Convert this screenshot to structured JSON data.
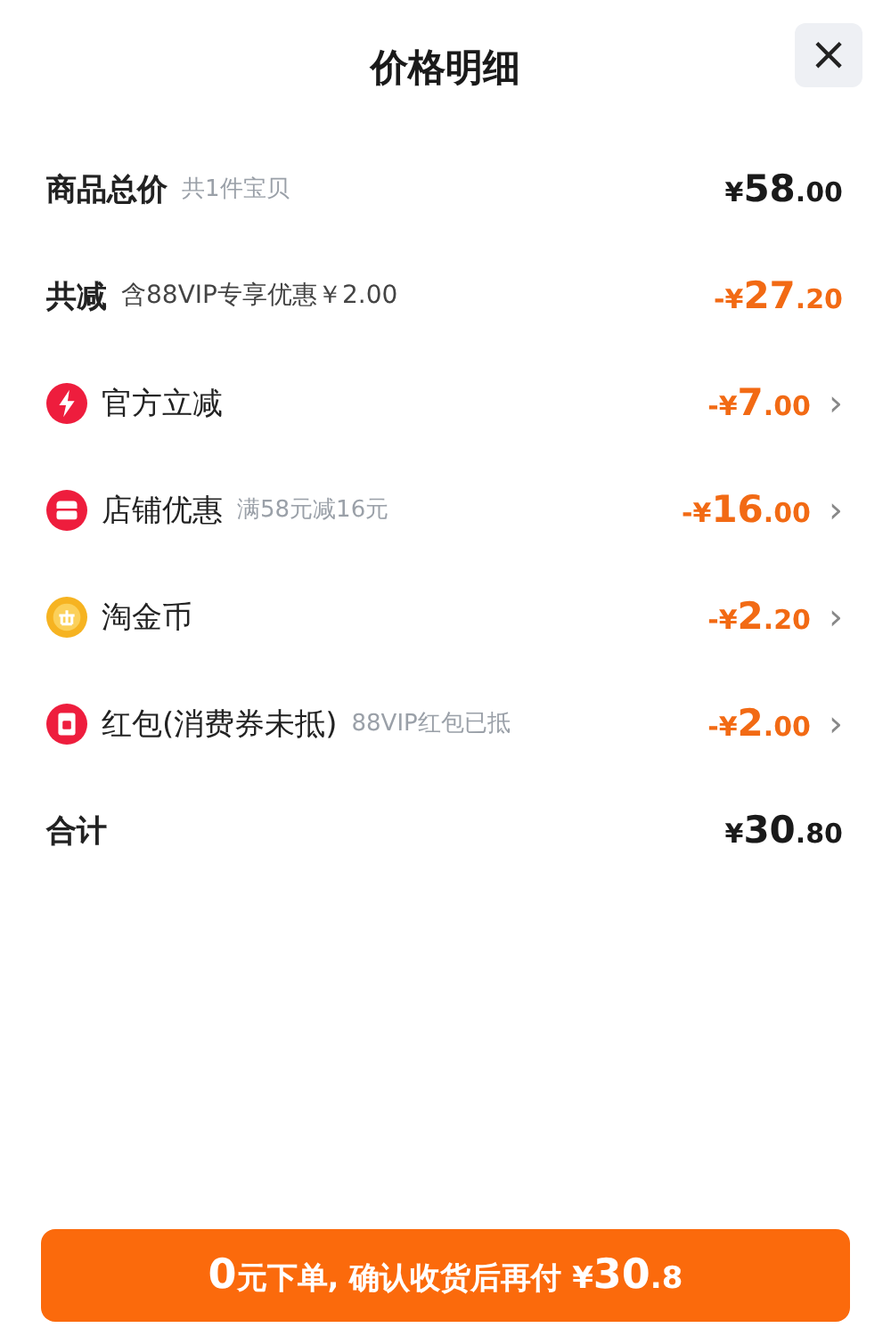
{
  "title": "价格明细",
  "close": "×",
  "rows": [
    {
      "kind": "total",
      "label": "商品总价",
      "note": "共1件宝贝",
      "amount": "¥58.00"
    },
    {
      "kind": "reduction",
      "label": "共减",
      "note": "含88VIP专享优惠￥2.00",
      "amount": "-¥27.20"
    },
    {
      "kind": "bolt",
      "label": "官方立减",
      "amount": "-¥7.00",
      "chevron": "›"
    },
    {
      "kind": "store",
      "label": "店铺优惠",
      "note": "满58元减16元",
      "amount": "-¥16.00",
      "chevron": "›"
    },
    {
      "kind": "coin",
      "label": "淘金币",
      "amount": "-¥2.20",
      "chevron": "›"
    },
    {
      "kind": "packet",
      "label": "红包(消费券未抵)",
      "note": "88VIP红包已抵",
      "amount": "-¥2.00",
      "chevron": "›"
    },
    {
      "kind": "total",
      "label": "合计",
      "amount": "¥30.80"
    }
  ],
  "button": {
    "lead": "0",
    "text": "元下单, 确认收货后再付 ¥",
    "amount": "30",
    "decimal": ".8"
  }
}
